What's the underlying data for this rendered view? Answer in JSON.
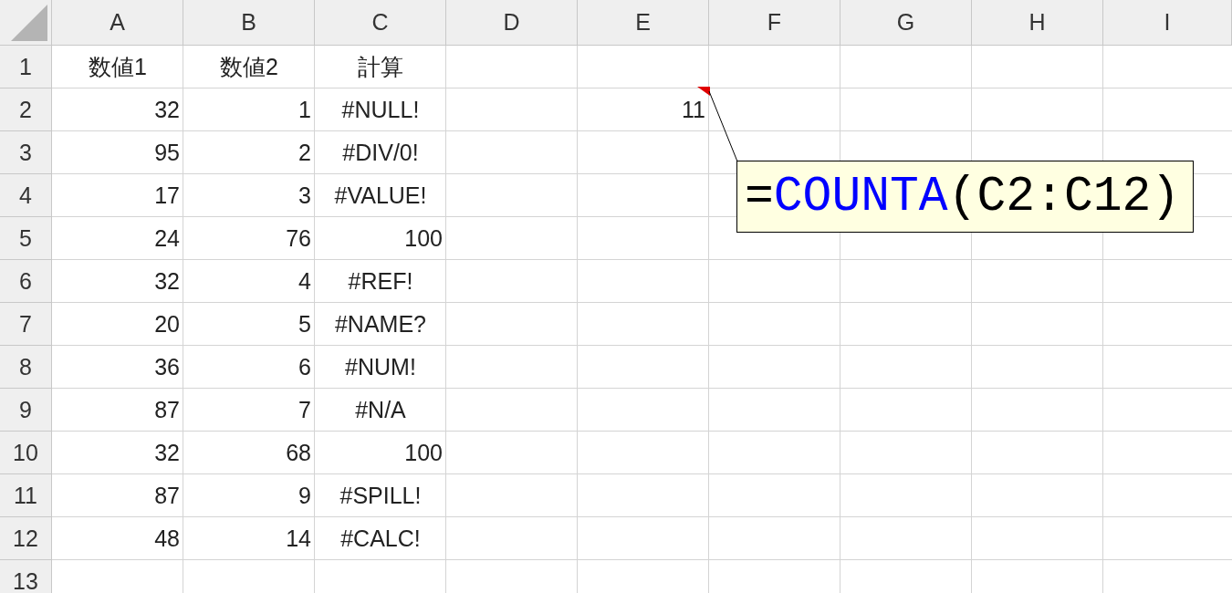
{
  "columns": [
    "A",
    "B",
    "C",
    "D",
    "E",
    "F",
    "G",
    "H",
    "I"
  ],
  "rows": [
    {
      "label": "1",
      "cells": {
        "A": {
          "text": "数値1",
          "kind": "text"
        },
        "B": {
          "text": "数値2",
          "kind": "text"
        },
        "C": {
          "text": "計算",
          "kind": "text"
        }
      }
    },
    {
      "label": "2",
      "cells": {
        "A": {
          "text": "32",
          "kind": "number"
        },
        "B": {
          "text": "1",
          "kind": "number"
        },
        "C": {
          "text": "#NULL!",
          "kind": "error"
        },
        "E": {
          "text": "11",
          "kind": "number"
        }
      }
    },
    {
      "label": "3",
      "cells": {
        "A": {
          "text": "95",
          "kind": "number"
        },
        "B": {
          "text": "2",
          "kind": "number"
        },
        "C": {
          "text": "#DIV/0!",
          "kind": "error"
        }
      }
    },
    {
      "label": "4",
      "cells": {
        "A": {
          "text": "17",
          "kind": "number"
        },
        "B": {
          "text": "3",
          "kind": "number"
        },
        "C": {
          "text": "#VALUE!",
          "kind": "error"
        }
      }
    },
    {
      "label": "5",
      "cells": {
        "A": {
          "text": "24",
          "kind": "number"
        },
        "B": {
          "text": "76",
          "kind": "number"
        },
        "C": {
          "text": "100",
          "kind": "number"
        }
      }
    },
    {
      "label": "6",
      "cells": {
        "A": {
          "text": "32",
          "kind": "number"
        },
        "B": {
          "text": "4",
          "kind": "number"
        },
        "C": {
          "text": "#REF!",
          "kind": "error"
        }
      }
    },
    {
      "label": "7",
      "cells": {
        "A": {
          "text": "20",
          "kind": "number"
        },
        "B": {
          "text": "5",
          "kind": "number"
        },
        "C": {
          "text": "#NAME?",
          "kind": "error"
        }
      }
    },
    {
      "label": "8",
      "cells": {
        "A": {
          "text": "36",
          "kind": "number"
        },
        "B": {
          "text": "6",
          "kind": "number"
        },
        "C": {
          "text": "#NUM!",
          "kind": "error"
        }
      }
    },
    {
      "label": "9",
      "cells": {
        "A": {
          "text": "87",
          "kind": "number"
        },
        "B": {
          "text": "7",
          "kind": "number"
        },
        "C": {
          "text": "#N/A",
          "kind": "error"
        }
      }
    },
    {
      "label": "10",
      "cells": {
        "A": {
          "text": "32",
          "kind": "number"
        },
        "B": {
          "text": "68",
          "kind": "number"
        },
        "C": {
          "text": "100",
          "kind": "number"
        }
      }
    },
    {
      "label": "11",
      "cells": {
        "A": {
          "text": "87",
          "kind": "number"
        },
        "B": {
          "text": "9",
          "kind": "number"
        },
        "C": {
          "text": "#SPILL!",
          "kind": "error"
        }
      }
    },
    {
      "label": "12",
      "cells": {
        "A": {
          "text": "48",
          "kind": "number"
        },
        "B": {
          "text": "14",
          "kind": "number"
        },
        "C": {
          "text": "#CALC!",
          "kind": "error"
        }
      }
    },
    {
      "label": "13",
      "cells": {}
    }
  ],
  "comment": {
    "parts": [
      {
        "text": "=",
        "color": "#000000"
      },
      {
        "text": "COUNTA",
        "color": "#0000ff"
      },
      {
        "text": "(C2:C12)",
        "color": "#000000"
      }
    ]
  }
}
